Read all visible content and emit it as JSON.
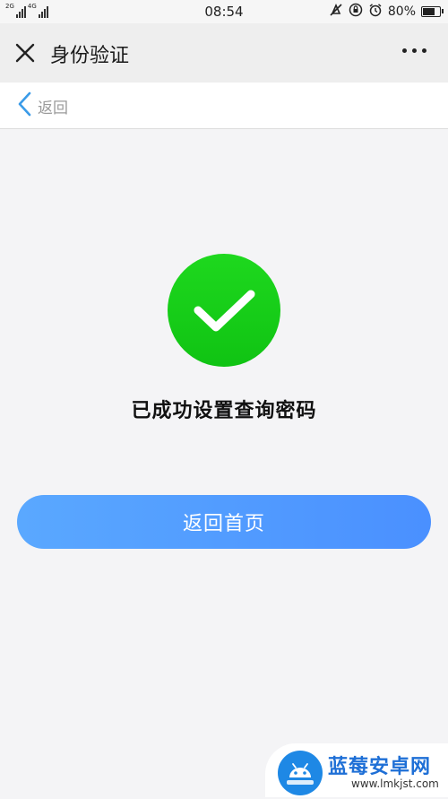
{
  "status_bar": {
    "network_left": "2G",
    "network_right": "4G",
    "time": "08:54",
    "battery_percent": "80%",
    "battery_level": 0.8
  },
  "titlebar": {
    "title": "身份验证"
  },
  "backbar": {
    "back_label": "返回"
  },
  "main": {
    "success_message": "已成功设置查询密码",
    "home_button_label": "返回首页"
  },
  "watermark": {
    "title": "蓝莓安卓网",
    "url": "www.lmkjst.com"
  },
  "colors": {
    "success_green": "#14c816",
    "button_blue": "#4a90ff",
    "back_arrow_blue": "#3a9be8"
  },
  "icons": [
    "close-icon",
    "more-icon",
    "back-chevron-icon",
    "checkmark-icon",
    "alarm-icon",
    "battery-icon"
  ]
}
